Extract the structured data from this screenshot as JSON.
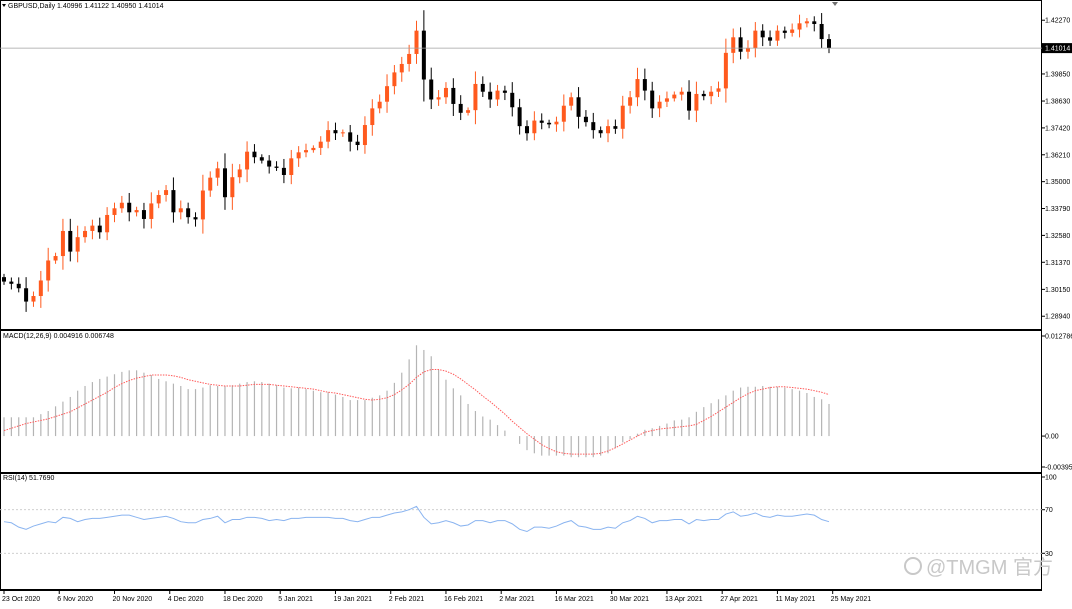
{
  "main": {
    "symbol_title": "GBPUSD,Daily  1.40996 1.41122 1.40950 1.41014",
    "price_axis_ticks": [
      "1.42270",
      "1.39850",
      "1.38630",
      "1.37420",
      "1.36210",
      "1.35000",
      "1.33790",
      "1.32580",
      "1.31370",
      "1.30150",
      "1.28940"
    ],
    "price_axis_values": [
      1.4227,
      1.3985,
      1.3863,
      1.3742,
      1.3621,
      1.35,
      1.3379,
      1.3258,
      1.3137,
      1.3015,
      1.2894
    ],
    "current_price_label": "1.41014",
    "current_price": 1.41014
  },
  "macd": {
    "title": "MACD(12,26,9) 0.004916 0.006748",
    "ticks": [
      "0.012786",
      "0.00",
      "-0.003952"
    ],
    "tick_values": [
      0.012786,
      0.0,
      -0.003952
    ]
  },
  "rsi": {
    "title": "RSI(14) 51.7690",
    "ticks": [
      "100",
      "70",
      "30"
    ],
    "tick_values": [
      100,
      70,
      30
    ]
  },
  "time_axis": {
    "labels": [
      "23 Oct 2020",
      "6 Nov 2020",
      "20 Nov 2020",
      "4 Dec 2020",
      "18 Dec 2020",
      "5 Jan 2021",
      "19 Jan 2021",
      "2 Feb 2021",
      "16 Feb 2021",
      "2 Mar 2021",
      "16 Mar 2021",
      "30 Mar 2021",
      "13 Apr 2021",
      "27 Apr 2021",
      "11 May 2021",
      "25 May 2021"
    ]
  },
  "watermark": {
    "text": "@TMGM 官方"
  },
  "colors": {
    "bull": "#ff5a1e",
    "bear": "#000000",
    "signal_line": "#ff5a5a",
    "histogram": "#b4b4b4",
    "rsi_line": "#8ab4f0",
    "grid_line": "#c8c8c8",
    "current_price_line": "#a0a0a0"
  },
  "chart_data": [
    {
      "type": "candlestick",
      "title": "GBPUSD,Daily",
      "ylim": [
        1.285,
        1.43
      ],
      "current_price": 1.41014,
      "close": [
        1.305,
        1.304,
        1.302,
        1.296,
        1.2985,
        1.3055,
        1.3145,
        1.3165,
        1.3278,
        1.3185,
        1.325,
        1.3278,
        1.3302,
        1.3272,
        1.335,
        1.338,
        1.3405,
        1.3362,
        1.3372,
        1.3332,
        1.3402,
        1.344,
        1.3462,
        1.3362,
        1.338,
        1.334,
        1.333,
        1.346,
        1.3518,
        1.356,
        1.343,
        1.352,
        1.3555,
        1.3635,
        1.361,
        1.3595,
        1.3568,
        1.3562,
        1.353,
        1.3605,
        1.3632,
        1.3642,
        1.3652,
        1.368,
        1.3732,
        1.3718,
        1.3722,
        1.368,
        1.3665,
        1.3755,
        1.383,
        1.386,
        1.393,
        1.3992,
        1.403,
        1.4075,
        1.418,
        1.396,
        1.387,
        1.388,
        1.3922,
        1.385,
        1.381,
        1.3822,
        1.394,
        1.3905,
        1.387,
        1.391,
        1.39,
        1.3835,
        1.375,
        1.3718,
        1.3775,
        1.3765,
        1.3758,
        1.377,
        1.3842,
        1.388,
        1.3792,
        1.3768,
        1.3732,
        1.3718,
        1.375,
        1.3738,
        1.3842,
        1.388,
        1.3962,
        1.391,
        1.383,
        1.386,
        1.3875,
        1.3892,
        1.3905,
        1.382,
        1.3895,
        1.3885,
        1.3905,
        1.392,
        1.408,
        1.415,
        1.4085,
        1.4102,
        1.418,
        1.415,
        1.4135,
        1.418,
        1.417,
        1.4185,
        1.4213,
        1.4222,
        1.421,
        1.4142,
        1.4101
      ]
    },
    {
      "type": "bar+line",
      "title": "MACD(12,26,9)",
      "histogram": [
        0.0024,
        0.0024,
        0.0024,
        0.0024,
        0.0024,
        0.0028,
        0.0032,
        0.0038,
        0.0044,
        0.005,
        0.0058,
        0.0064,
        0.0069,
        0.0073,
        0.0076,
        0.0079,
        0.0082,
        0.0084,
        0.0084,
        0.0081,
        0.0078,
        0.0073,
        0.007,
        0.0067,
        0.0064,
        0.006,
        0.006,
        0.0062,
        0.0065,
        0.0064,
        0.0064,
        0.0065,
        0.0067,
        0.0069,
        0.007,
        0.0069,
        0.0067,
        0.0065,
        0.0062,
        0.0061,
        0.0062,
        0.006,
        0.0058,
        0.0056,
        0.0056,
        0.0053,
        0.005,
        0.0046,
        0.0046,
        0.0046,
        0.0049,
        0.0052,
        0.0058,
        0.0068,
        0.0081,
        0.0098,
        0.0116,
        0.011,
        0.0102,
        0.0085,
        0.0072,
        0.0061,
        0.0052,
        0.0041,
        0.0032,
        0.0025,
        0.0021,
        0.0014,
        0.0007,
        0.0,
        -0.001,
        -0.0018,
        -0.0022,
        -0.0025,
        -0.0025,
        -0.0025,
        -0.0025,
        -0.0027,
        -0.0027,
        -0.0027,
        -0.0027,
        -0.0025,
        -0.0022,
        -0.0015,
        -0.0008,
        -0.0004,
        0.0003,
        0.0008,
        0.001,
        0.0013,
        0.0016,
        0.002,
        0.0021,
        0.0024,
        0.0031,
        0.0037,
        0.0042,
        0.0047,
        0.0052,
        0.0058,
        0.0062,
        0.0063,
        0.0063,
        0.0064,
        0.0063,
        0.0063,
        0.0062,
        0.006,
        0.0058,
        0.0055,
        0.005,
        0.0047,
        0.0041
      ],
      "signal": [
        0.0007,
        0.001,
        0.0013,
        0.0016,
        0.0018,
        0.002,
        0.0022,
        0.0025,
        0.0028,
        0.0031,
        0.0036,
        0.0041,
        0.0046,
        0.0051,
        0.0056,
        0.0062,
        0.0067,
        0.0071,
        0.0074,
        0.0076,
        0.0078,
        0.0078,
        0.0078,
        0.0077,
        0.0075,
        0.0072,
        0.007,
        0.0068,
        0.0066,
        0.0065,
        0.0064,
        0.0064,
        0.0064,
        0.0065,
        0.0066,
        0.0066,
        0.0066,
        0.0065,
        0.0064,
        0.0063,
        0.0062,
        0.0061,
        0.006,
        0.0058,
        0.0056,
        0.0055,
        0.0053,
        0.0051,
        0.0049,
        0.0047,
        0.0046,
        0.0047,
        0.0049,
        0.0053,
        0.0059,
        0.0066,
        0.0075,
        0.0082,
        0.0085,
        0.0085,
        0.0083,
        0.0079,
        0.0073,
        0.0066,
        0.0059,
        0.0051,
        0.0044,
        0.0036,
        0.0028,
        0.0019,
        0.0011,
        0.0003,
        -0.0004,
        -0.0011,
        -0.0016,
        -0.002,
        -0.0022,
        -0.0023,
        -0.0023,
        -0.0023,
        -0.0023,
        -0.0022,
        -0.0019,
        -0.0015,
        -0.001,
        -0.0005,
        0.0,
        0.0005,
        0.0007,
        0.0009,
        0.001,
        0.0011,
        0.0012,
        0.0013,
        0.0015,
        0.002,
        0.0025,
        0.0031,
        0.0037,
        0.0043,
        0.0049,
        0.0054,
        0.0058,
        0.006,
        0.0062,
        0.0063,
        0.0063,
        0.0062,
        0.0061,
        0.006,
        0.0058,
        0.0056,
        0.0053
      ],
      "ylim": [
        -0.003952,
        0.012786
      ]
    },
    {
      "type": "line",
      "title": "RSI(14)",
      "values": [
        59,
        58,
        54,
        52,
        55,
        57,
        59,
        58,
        63,
        62,
        59,
        61,
        62,
        62,
        63,
        64,
        65,
        65,
        63,
        61,
        62,
        63,
        64,
        62,
        59,
        58,
        58,
        61,
        62,
        64,
        58,
        61,
        61,
        63,
        63,
        62,
        60,
        61,
        60,
        62,
        62,
        63,
        63,
        63,
        63,
        62,
        62,
        60,
        59,
        61,
        63,
        63,
        65,
        67,
        68,
        70,
        73,
        63,
        57,
        58,
        60,
        58,
        55,
        56,
        60,
        60,
        58,
        60,
        60,
        57,
        52,
        50,
        54,
        54,
        53,
        55,
        58,
        60,
        55,
        54,
        52,
        52,
        54,
        53,
        58,
        60,
        64,
        62,
        58,
        60,
        60,
        61,
        61,
        57,
        61,
        60,
        61,
        61,
        66,
        68,
        64,
        65,
        67,
        64,
        63,
        65,
        64,
        64,
        65,
        66,
        65,
        61,
        59
      ]
    }
  ]
}
